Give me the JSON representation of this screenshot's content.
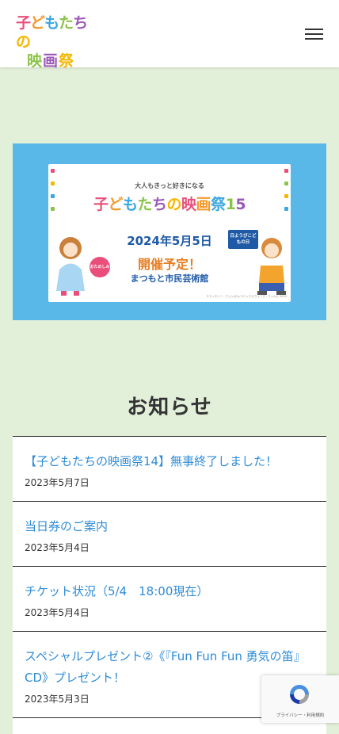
{
  "header": {
    "logo_line1": "子どもたちの",
    "logo_line2": "映画祭"
  },
  "banner": {
    "subtitle": "大人もきっと好きになる",
    "title": "子どもたちの映画祭15",
    "date": "2024年5月5日",
    "badge": "日ようびこどもの日",
    "status": "開催予定！",
    "venue": "まつもと市民芸術館",
    "tag": "おたのしみに",
    "copyright": "©ティモシー・ウェンゼル/コミックスウェーブ・フィルム 2024"
  },
  "section": {
    "title": "お知らせ"
  },
  "news": [
    {
      "title": "【子どもたちの映画祭14】無事終了しました！",
      "date": "2023年5月7日"
    },
    {
      "title": "当日券のご案内",
      "date": "2023年5月4日"
    },
    {
      "title": "チケット状況（5/4　18:00現在）",
      "date": "2023年5月4日"
    },
    {
      "title": "スペシャルプレゼント②《『Fun Fun Fun 勇気の笛』CD》プレゼント！",
      "date": "2023年5月3日"
    }
  ],
  "recaptcha": {
    "text": "プライバシー・利用規約"
  },
  "colors": {
    "accent_link": "#2e8bd6",
    "page_bg": "#e2efd9",
    "banner_bg": "#5ab8e8"
  }
}
